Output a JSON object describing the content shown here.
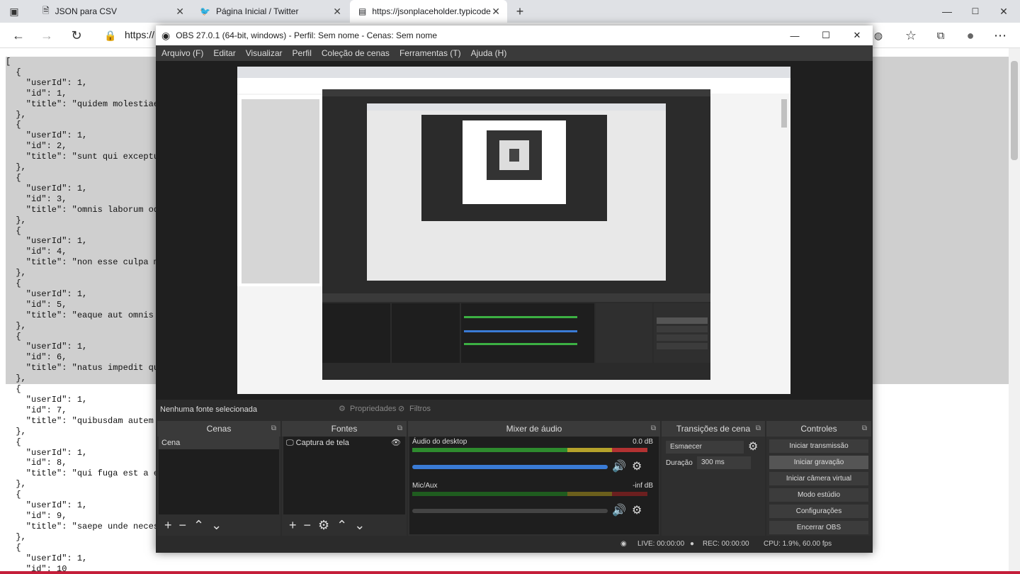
{
  "browser": {
    "tabs": [
      {
        "label": "JSON para CSV"
      },
      {
        "label": "Página Inicial / Twitter"
      },
      {
        "label": "https://jsonplaceholder.typicode"
      }
    ],
    "address": "https://"
  },
  "json_lines": [
    "[",
    "  {",
    "    \"userId\": 1,",
    "    \"id\": 1,",
    "    \"title\": \"quidem molestiae e",
    "  },",
    "  {",
    "    \"userId\": 1,",
    "    \"id\": 2,",
    "    \"title\": \"sunt qui excepturi",
    "  },",
    "  {",
    "    \"userId\": 1,",
    "    \"id\": 3,",
    "    \"title\": \"omnis laborum odio",
    "  },",
    "  {",
    "    \"userId\": 1,",
    "    \"id\": 4,",
    "    \"title\": \"non esse culpa mol",
    "  },",
    "  {",
    "    \"userId\": 1,",
    "    \"id\": 5,",
    "    \"title\": \"eaque aut omnis a\"",
    "  },",
    "  {",
    "    \"userId\": 1,",
    "    \"id\": 6,",
    "    \"title\": \"natus impedit quib",
    "  },",
    "  {",
    "    \"userId\": 1,",
    "    \"id\": 7,",
    "    \"title\": \"quibusdam autem al",
    "  },",
    "  {",
    "    \"userId\": 1,",
    "    \"id\": 8,",
    "    \"title\": \"qui fuga est a eum",
    "  },",
    "  {",
    "    \"userId\": 1,",
    "    \"id\": 9,",
    "    \"title\": \"saepe unde necessi",
    "  },",
    "  {",
    "    \"userId\": 1,",
    "    \"id\": 10"
  ],
  "obs": {
    "title": "OBS 27.0.1 (64-bit, windows) - Perfil: Sem nome - Cenas: Sem nome",
    "menu": [
      "Arquivo (F)",
      "Editar",
      "Visualizar",
      "Perfil",
      "Coleção de cenas",
      "Ferramentas (T)",
      "Ajuda (H)"
    ],
    "no_source": "Nenhuma fonte selecionada",
    "properties": "Propriedades",
    "filters": "Filtros",
    "docks": {
      "scenes": "Cenas",
      "sources": "Fontes",
      "mixer": "Mixer de áudio",
      "transitions": "Transições de cena",
      "controls": "Controles"
    },
    "scene_item": "Cena",
    "source_item": "Captura de tela",
    "mixer": {
      "ch1_name": "Áudio do desktop",
      "ch1_level": "0.0 dB",
      "ch2_name": "Mic/Aux",
      "ch2_level": "-inf dB"
    },
    "transition": "Esmaecer",
    "duration_label": "Duração",
    "duration_value": "300 ms",
    "controls": [
      "Iniciar transmissão",
      "Iniciar gravação",
      "Iniciar câmera virtual",
      "Modo estúdio",
      "Configurações",
      "Encerrar OBS"
    ],
    "status": {
      "live": "LIVE: 00:00:00",
      "rec": "REC: 00:00:00",
      "cpu": "CPU: 1.9%, 60.00 fps"
    }
  }
}
